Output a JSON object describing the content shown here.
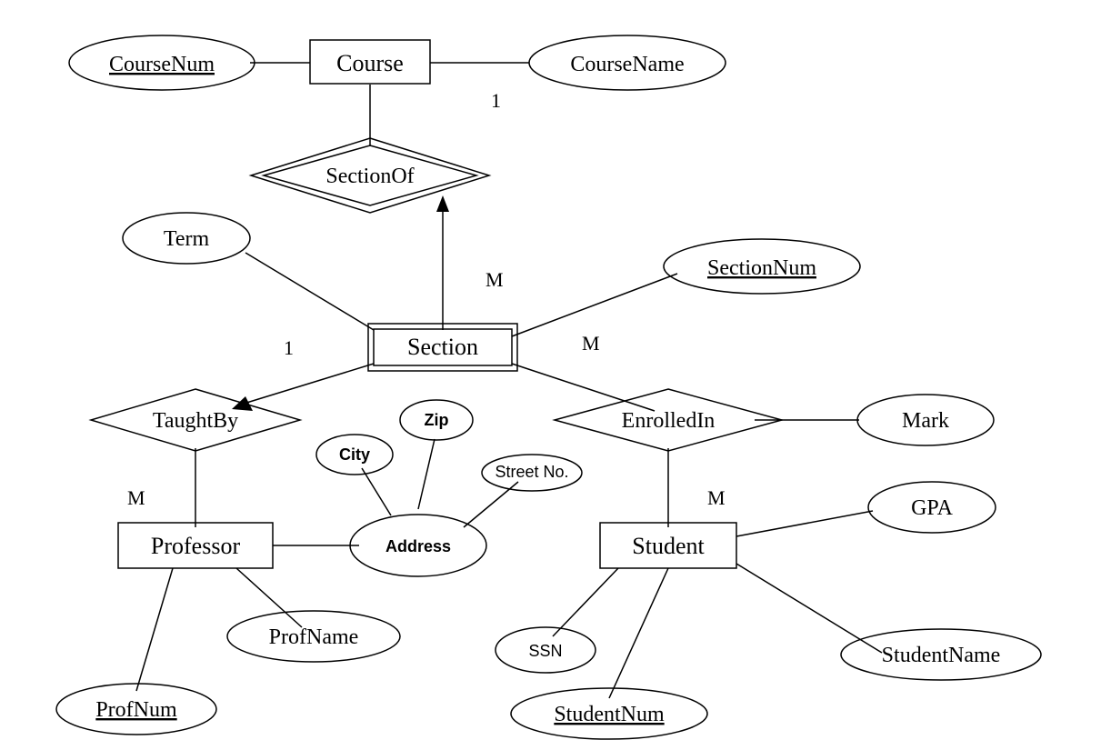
{
  "entities": {
    "course": {
      "label": "Course"
    },
    "section": {
      "label": "Section"
    },
    "professor": {
      "label": "Professor"
    },
    "student": {
      "label": "Student"
    }
  },
  "relationships": {
    "sectionOf": {
      "label": "SectionOf"
    },
    "taughtBy": {
      "label": "TaughtBy"
    },
    "enrolledIn": {
      "label": "EnrolledIn"
    }
  },
  "attributes": {
    "courseNum": {
      "label": "CourseNum"
    },
    "courseName": {
      "label": "CourseName"
    },
    "term": {
      "label": "Term"
    },
    "sectionNum": {
      "label": "SectionNum"
    },
    "mark": {
      "label": "Mark"
    },
    "gpa": {
      "label": "GPA"
    },
    "studentName": {
      "label": "StudentName"
    },
    "studentNum": {
      "label": "StudentNum"
    },
    "ssn": {
      "label": "SSN"
    },
    "profName": {
      "label": "ProfName"
    },
    "profNum": {
      "label": "ProfNum"
    },
    "address": {
      "label": "Address"
    },
    "city": {
      "label": "City"
    },
    "zip": {
      "label": "Zip"
    },
    "streetNo": {
      "label": "Street No."
    }
  },
  "cardinalities": {
    "course_sectionOf": "1",
    "sectionOf_section": "M",
    "section_taughtBy": "1",
    "taughtBy_professor": "M",
    "section_enrolledIn": "M",
    "enrolledIn_student": "M"
  }
}
